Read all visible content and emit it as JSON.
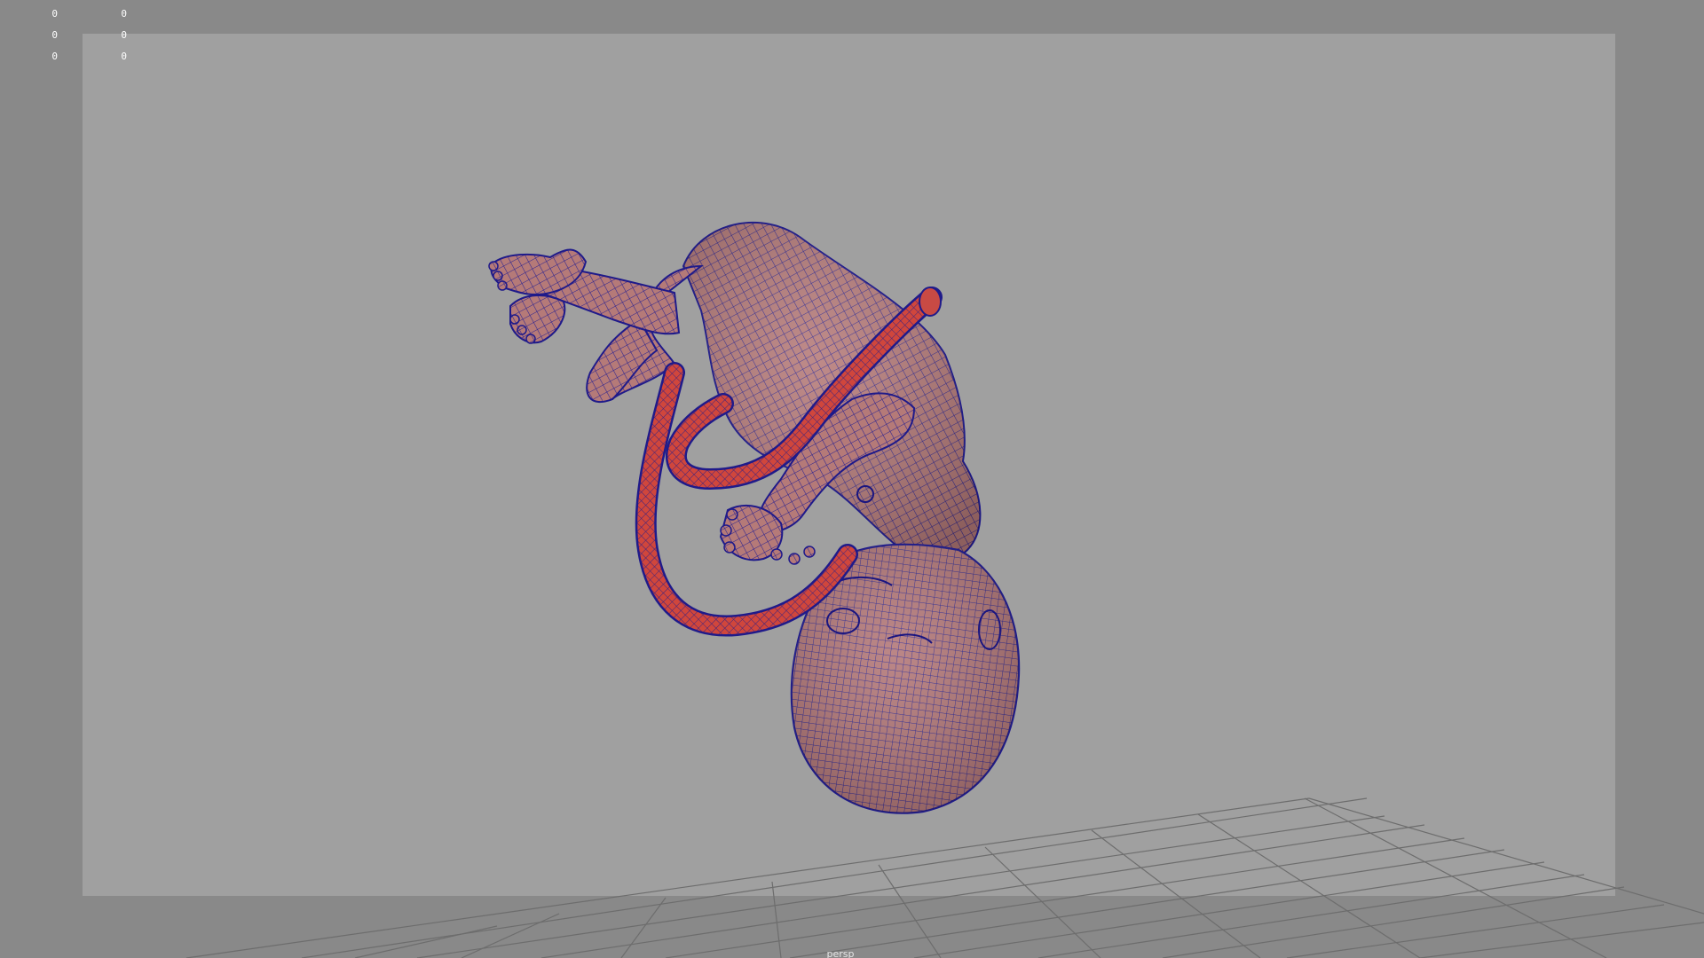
{
  "app": {
    "window_type": "3D modeling viewport",
    "view": "perspective"
  },
  "hud": {
    "col1": [
      "0",
      "0",
      "0"
    ],
    "col2": [
      "0",
      "0",
      "0"
    ]
  },
  "viewport": {
    "camera_label": "persp",
    "background_color": "#898989",
    "gate_color": "#a0a0a0",
    "grid_color": "#6d6d6d",
    "wire_color": "#1f1a8a",
    "mesh_color": "#b57a78",
    "cord_color": "#d0463c"
  },
  "scene": {
    "objects": [
      "fetus-mesh",
      "umbilical-cord-mesh",
      "ground-grid"
    ]
  }
}
